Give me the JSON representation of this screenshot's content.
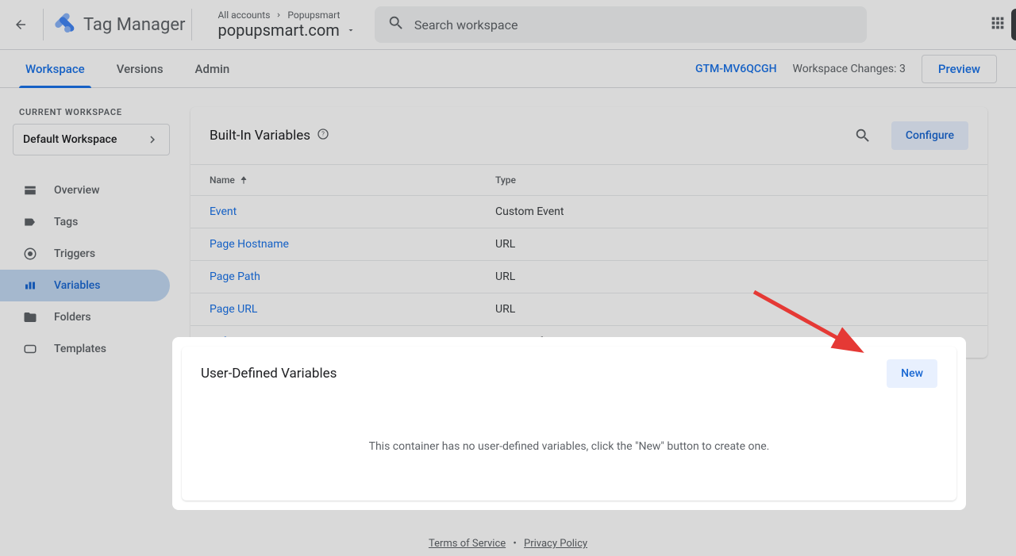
{
  "header": {
    "product_name": "Tag Manager",
    "breadcrumb_all": "All accounts",
    "breadcrumb_account": "Popupsmart",
    "container_name": "popupsmart.com",
    "search_placeholder": "Search workspace"
  },
  "tabs": {
    "workspace": "Workspace",
    "versions": "Versions",
    "admin": "Admin",
    "container_id": "GTM-MV6QCGH",
    "changes_label": "Workspace Changes:",
    "changes_count": "3",
    "preview": "Preview"
  },
  "sidebar": {
    "current_workspace_label": "CURRENT WORKSPACE",
    "workspace_name": "Default Workspace",
    "items": [
      {
        "label": "Overview"
      },
      {
        "label": "Tags"
      },
      {
        "label": "Triggers"
      },
      {
        "label": "Variables"
      },
      {
        "label": "Folders"
      },
      {
        "label": "Templates"
      }
    ]
  },
  "builtin": {
    "title": "Built-In Variables",
    "configure": "Configure",
    "col_name": "Name",
    "col_type": "Type",
    "rows": [
      {
        "name": "Event",
        "type": "Custom Event"
      },
      {
        "name": "Page Hostname",
        "type": "URL"
      },
      {
        "name": "Page Path",
        "type": "URL"
      },
      {
        "name": "Page URL",
        "type": "URL"
      },
      {
        "name": "Referrer",
        "type": "HTTP Referrer"
      }
    ]
  },
  "udv": {
    "title": "User-Defined Variables",
    "new": "New",
    "empty": "This container has no user-defined variables, click the \"New\" button to create one."
  },
  "footer": {
    "tos": "Terms of Service",
    "privacy": "Privacy Policy"
  }
}
